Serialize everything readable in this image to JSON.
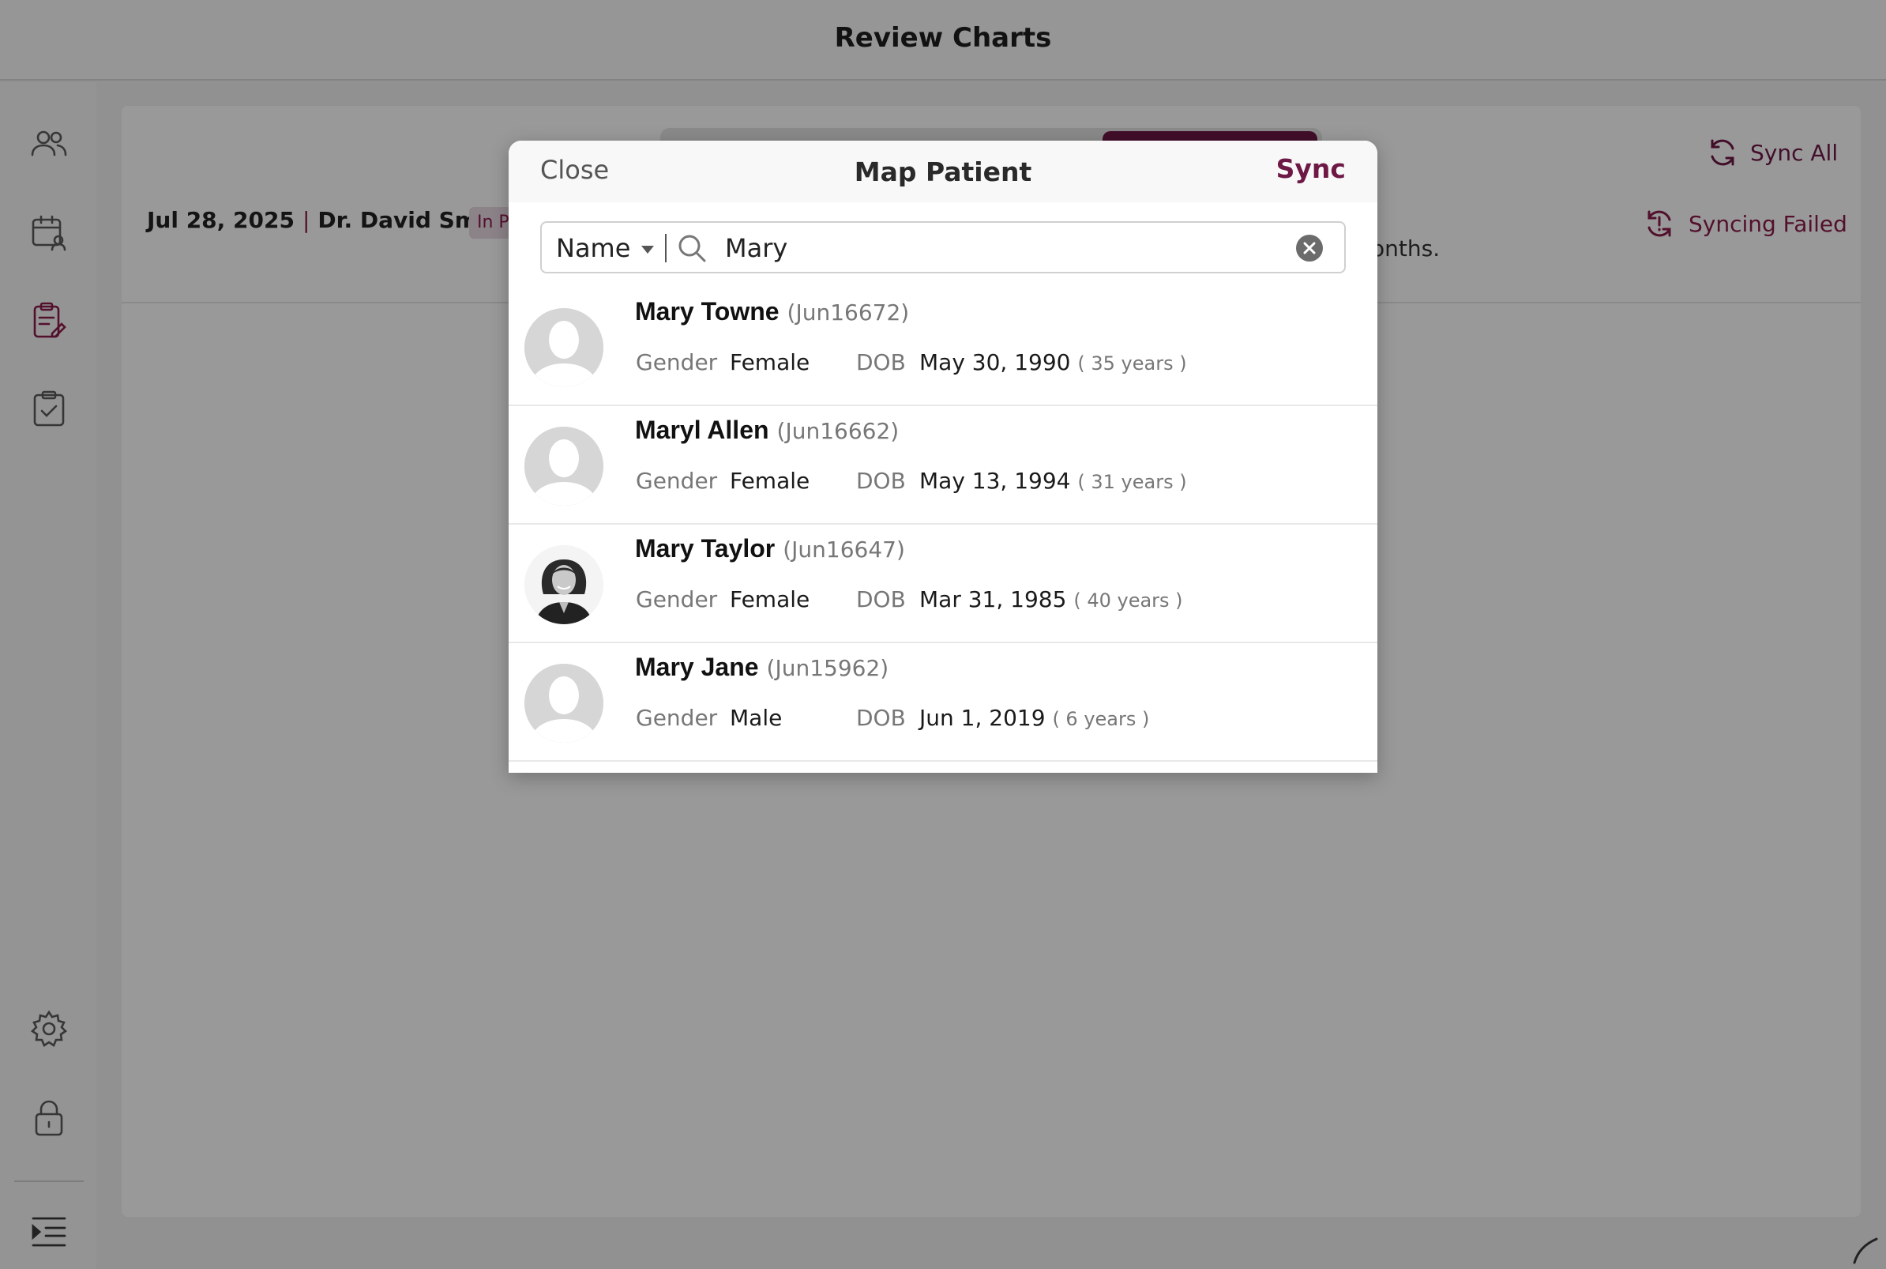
{
  "app": {
    "title": "Review Charts"
  },
  "sidebar": {
    "items": [
      {
        "name": "patients",
        "icon": "users-icon"
      },
      {
        "name": "schedule",
        "icon": "calendar-user-icon"
      },
      {
        "name": "review-charts",
        "icon": "clipboard-edit-icon",
        "active": true
      },
      {
        "name": "tasks",
        "icon": "clipboard-check-icon"
      }
    ],
    "bottom_items": [
      {
        "name": "settings",
        "icon": "gear-icon"
      },
      {
        "name": "lock",
        "icon": "lock-icon"
      },
      {
        "name": "collapse",
        "icon": "menu-indent-icon"
      }
    ]
  },
  "background": {
    "chart_date": "Jul 28, 2025",
    "separator": "|",
    "doctor": "Dr. David Smith",
    "status_chip": "In P",
    "snippet": "onths.",
    "sync_all": "Sync All",
    "syncing_failed": "Syncing Failed"
  },
  "colors": {
    "accent": "#6e1846",
    "accent_light": "#8a1c4a"
  },
  "modal": {
    "title": "Map Patient",
    "close_label": "Close",
    "sync_label": "Sync",
    "search": {
      "filter_value": "Name",
      "value": "Mary"
    },
    "labels": {
      "gender": "Gender",
      "dob": "DOB"
    },
    "results": [
      {
        "name": "Mary Towne",
        "id": "(Jun16672)",
        "gender": "Female",
        "dob": "May 30, 1990",
        "age": "( 35 years )",
        "avatar": "default"
      },
      {
        "name": "Maryl Allen",
        "id": "(Jun16662)",
        "gender": "Female",
        "dob": "May 13, 1994",
        "age": "( 31 years )",
        "avatar": "default"
      },
      {
        "name": "Mary Taylor",
        "id": "(Jun16647)",
        "gender": "Female",
        "dob": "Mar 31, 1985",
        "age": "( 40 years )",
        "avatar": "photo"
      },
      {
        "name": "Mary Jane",
        "id": "(Jun15962)",
        "gender": "Male",
        "dob": "Jun 1, 2019",
        "age": "( 6 years )",
        "avatar": "default"
      }
    ]
  }
}
